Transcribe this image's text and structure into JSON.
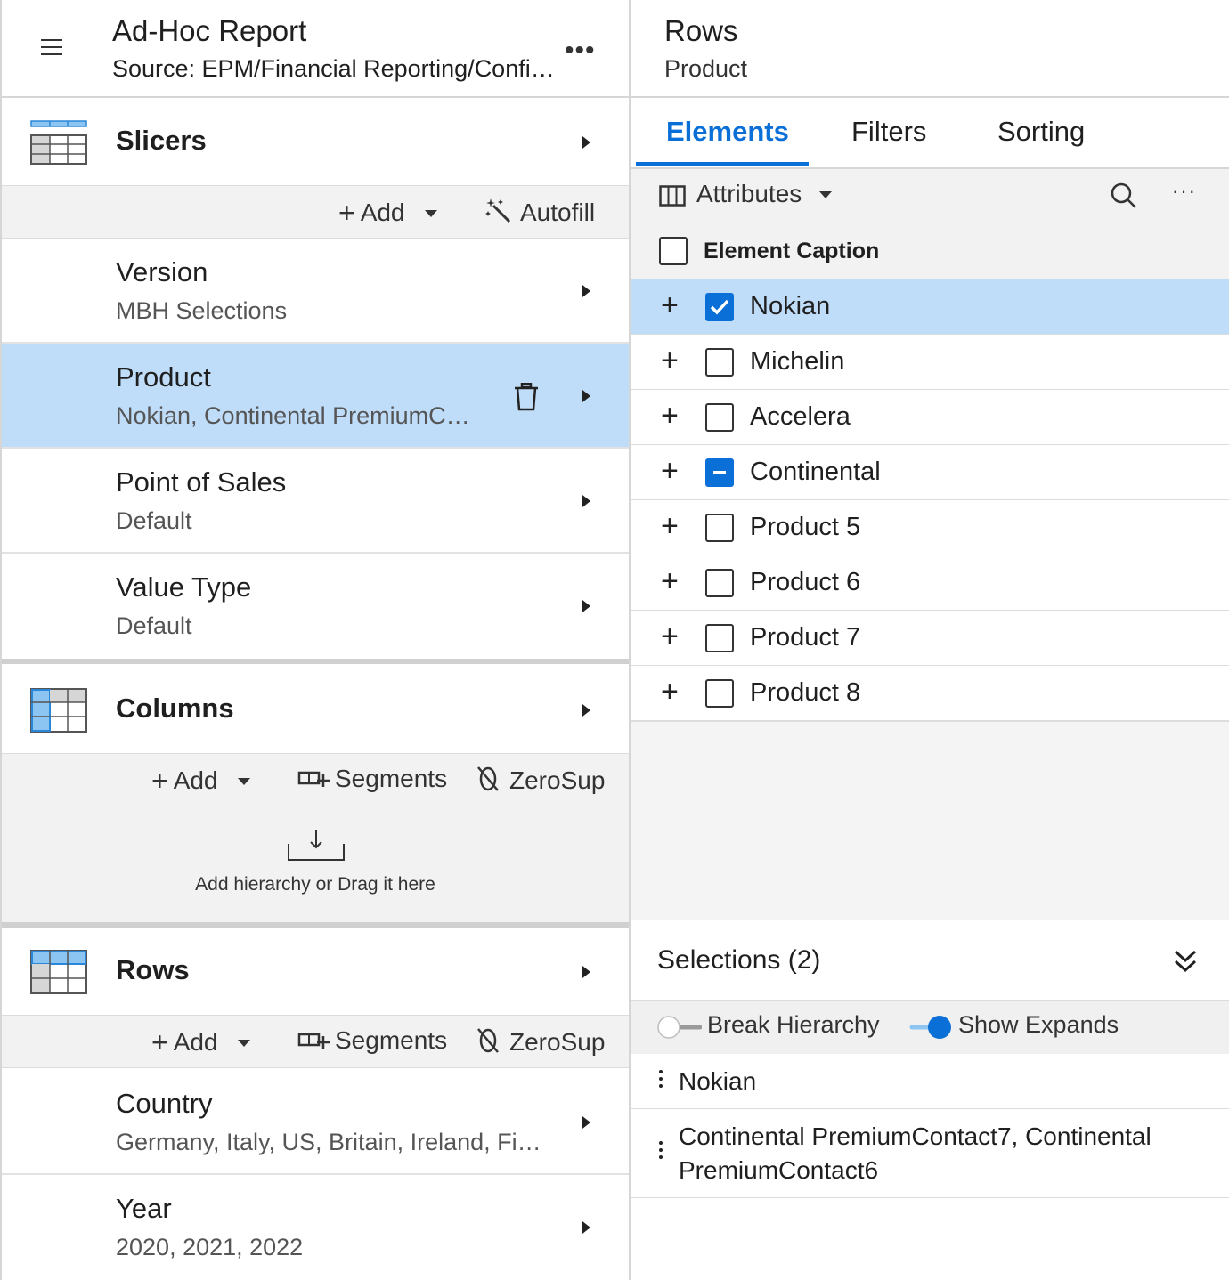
{
  "report": {
    "title": "Ad-Hoc Report",
    "source": "Source: EPM/Financial Reporting/Config…"
  },
  "slicers": {
    "label": "Slicers",
    "add_label": "Add",
    "autofill_label": "Autofill",
    "items": [
      {
        "name": "Version",
        "value": "MBH Selections"
      },
      {
        "name": "Product",
        "value": "Nokian, Continental PremiumCo…"
      },
      {
        "name": "Point of Sales",
        "value": "Default"
      },
      {
        "name": "Value Type",
        "value": "Default"
      }
    ]
  },
  "columns": {
    "label": "Columns",
    "add_label": "Add",
    "segments_label": "Segments",
    "zerosup_label": "ZeroSup",
    "drop_hint": "Add hierarchy or Drag it here"
  },
  "rows_section": {
    "label": "Rows",
    "add_label": "Add",
    "segments_label": "Segments",
    "zerosup_label": "ZeroSup",
    "items": [
      {
        "name": "Country",
        "value": "Germany, Italy, US, Britain, Ireland, Fin…"
      },
      {
        "name": "Year",
        "value": "2020, 2021, 2022"
      }
    ]
  },
  "detail": {
    "title": "Rows",
    "subtitle": "Product",
    "tabs": [
      "Elements",
      "Filters",
      "Sorting"
    ],
    "active_tab": "Elements",
    "attributes_label": "Attributes",
    "caption_label": "Element Caption",
    "elements": [
      {
        "name": "Nokian",
        "state": "checked"
      },
      {
        "name": "Michelin",
        "state": "unchecked"
      },
      {
        "name": "Accelera",
        "state": "unchecked"
      },
      {
        "name": "Continental",
        "state": "partial"
      },
      {
        "name": "Product 5",
        "state": "unchecked"
      },
      {
        "name": "Product 6",
        "state": "unchecked"
      },
      {
        "name": "Product 7",
        "state": "unchecked"
      },
      {
        "name": "Product 8",
        "state": "unchecked"
      }
    ],
    "selections_label": "Selections (2)",
    "break_hierarchy_label": "Break Hierarchy",
    "break_hierarchy_on": false,
    "show_expands_label": "Show Expands",
    "show_expands_on": true,
    "selections": [
      "Nokian",
      "Continental PremiumContact7, Continental PremiumContact6"
    ]
  },
  "colors": {
    "accent": "#0a6fd6",
    "selected_bg": "#bfdcf8",
    "toolbar_bg": "#f2f2f2"
  }
}
